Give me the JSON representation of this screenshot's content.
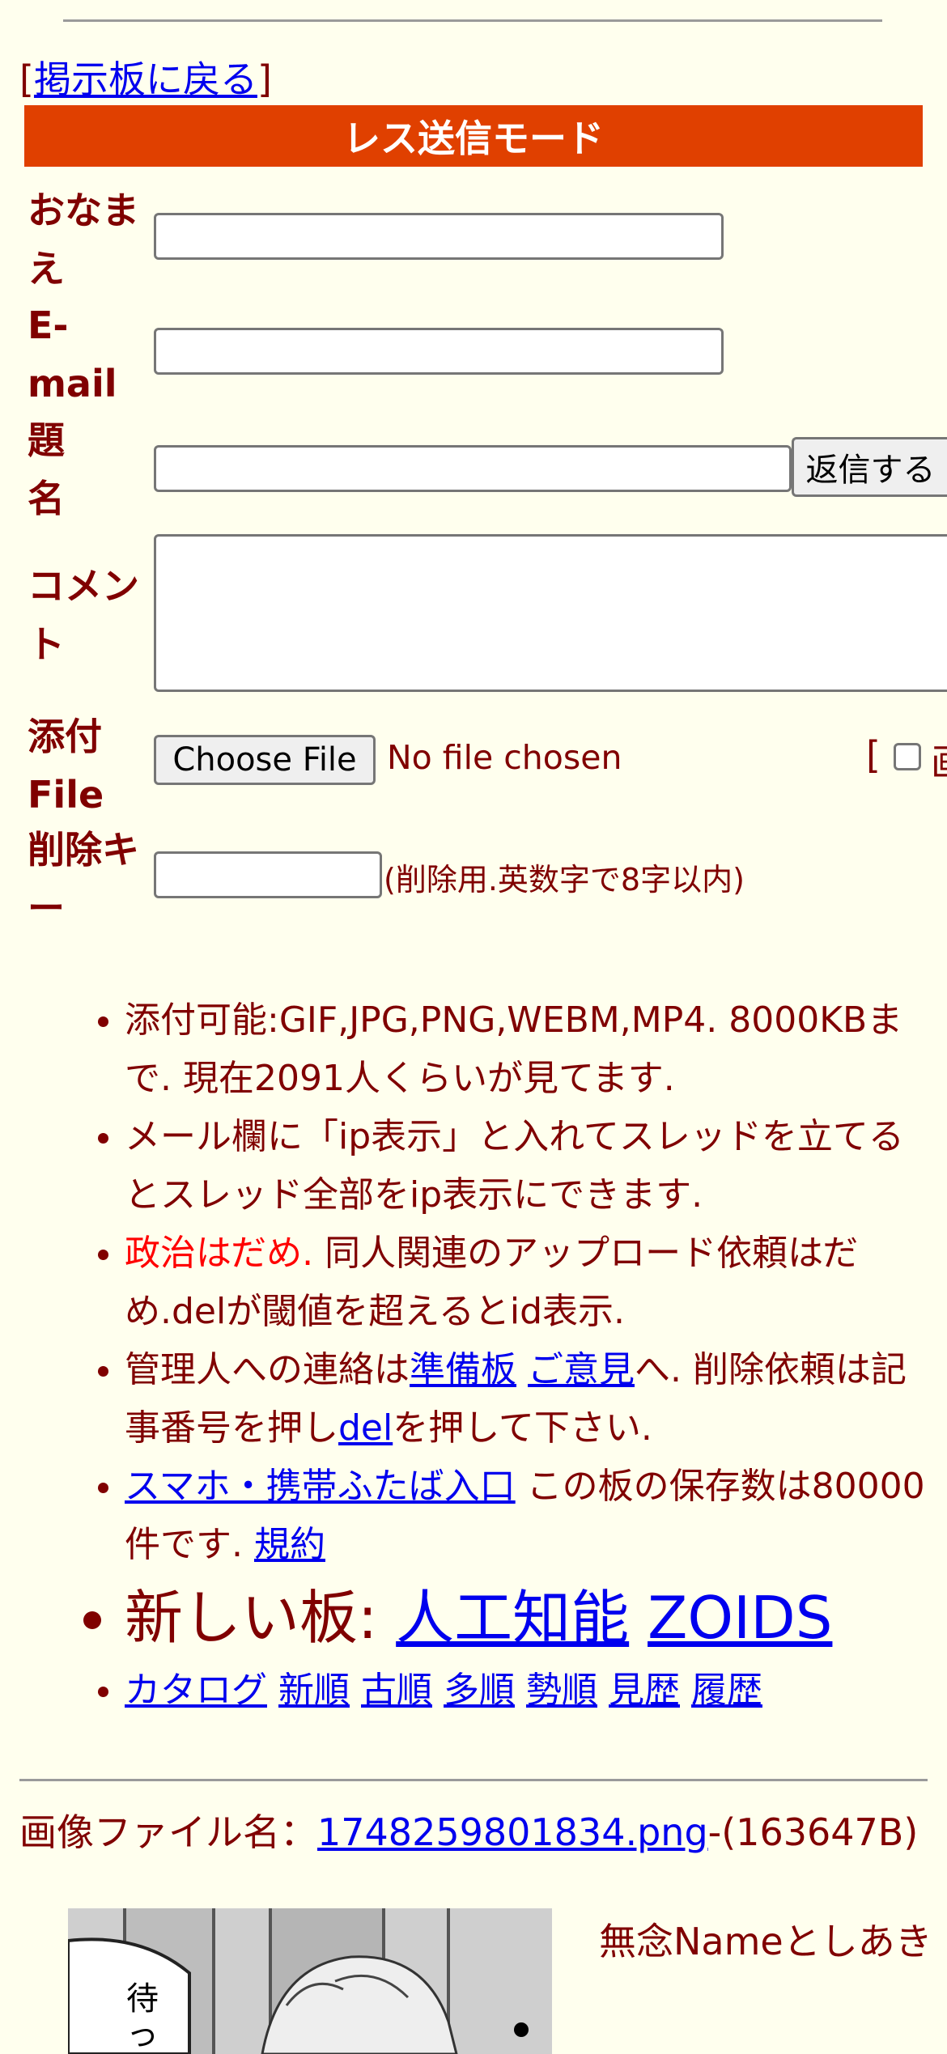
{
  "nav": {
    "bracket_open": "[",
    "back_label": "掲示板に戻る",
    "bracket_close": "]"
  },
  "mode_title": "レス送信モード",
  "form": {
    "name_label": "おなまえ",
    "email_label": "E-mail",
    "subject_label": "題名",
    "submit_label": "返信する",
    "comment_label": "コメント",
    "file_label": "添付File",
    "choose_file_label": "Choose File",
    "no_file_text": "No file chosen",
    "image_option_bracket": "[",
    "image_option_label": "画",
    "delkey_label": "削除キー",
    "delkey_hint": "(削除用.英数字で8字以内)"
  },
  "rules": {
    "item1": "添付可能:GIF,JPG,PNG,WEBM,MP4. 8000KBまで. 現在2091人くらいが見てます.",
    "item2": "メール欄に「ip表示」と入れてスレッドを立てるとスレッド全部をip表示にできます.",
    "item3_red": "政治はだめ.",
    "item3_rest": " 同人関連のアップロード依頼はだめ.delが閾値を超えるとid表示.",
    "item4_pre": "管理人への連絡は",
    "item4_link1": "準備板",
    "item4_link2": "ご意見",
    "item4_mid": "へ. 削除依頼は記事番号を押し",
    "item4_link3": "del",
    "item4_post": "を押して下さい.",
    "item5_link": "スマホ・携帯ふたば入口",
    "item5_mid": " この板の保存数は80000件です. ",
    "item5_link2": "規約",
    "new_boards_label": "新しい板: ",
    "new_board1": "人工知能",
    "new_board2": "ZOIDS",
    "sort_links": [
      "カタログ",
      "新順",
      "古順",
      "多順",
      "勢順",
      "見歴",
      "履歴"
    ]
  },
  "post": {
    "file_label": "画像ファイル名：",
    "file_name": "1748259801834.png",
    "file_size": "-(163647B)",
    "poster_text": "無念Nameとしあき",
    "thumb_text": "待っ"
  }
}
